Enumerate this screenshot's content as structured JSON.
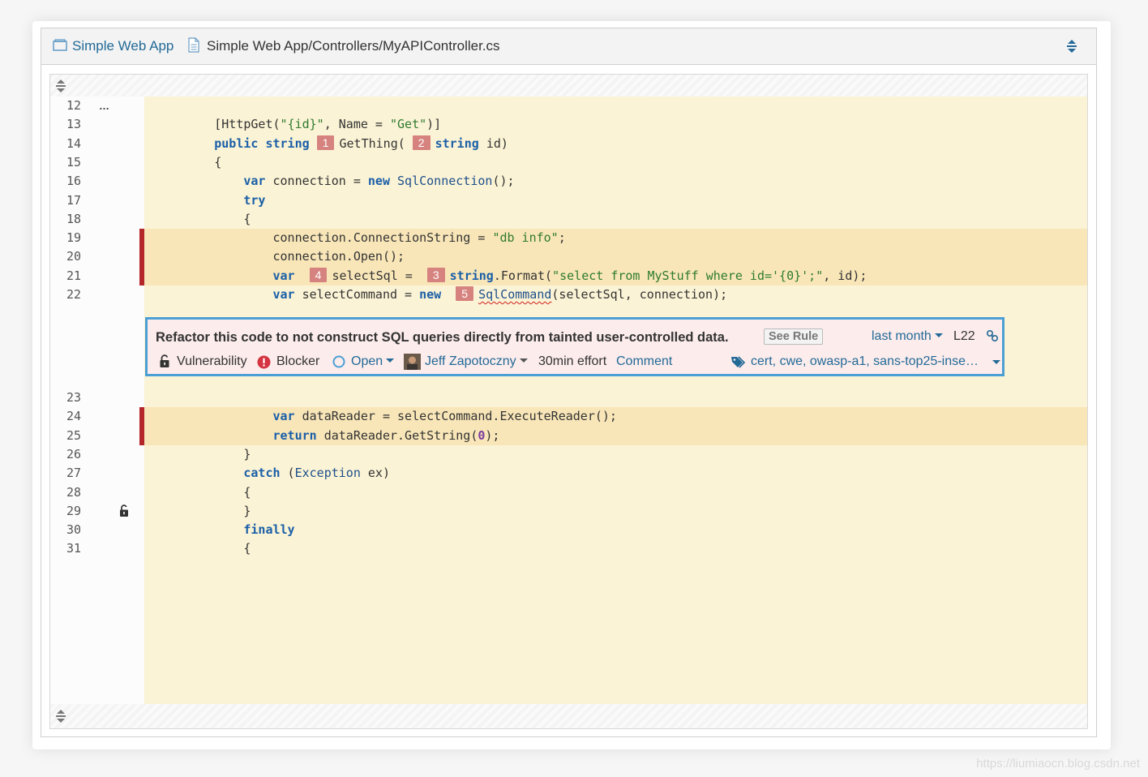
{
  "header": {
    "project_link": "Simple Web App",
    "file_path": "Simple Web App/Controllers/MyAPIController.cs"
  },
  "code_lines": [
    {
      "n": "12"
    },
    {
      "n": "13"
    },
    {
      "n": "14"
    },
    {
      "n": "15"
    },
    {
      "n": "16"
    },
    {
      "n": "17"
    },
    {
      "n": "18"
    },
    {
      "n": "19"
    },
    {
      "n": "20"
    },
    {
      "n": "21"
    },
    {
      "n": "22"
    },
    {
      "n": "23"
    },
    {
      "n": "24"
    },
    {
      "n": "25"
    },
    {
      "n": "26"
    },
    {
      "n": "27"
    },
    {
      "n": "28"
    },
    {
      "n": "29"
    },
    {
      "n": "30"
    },
    {
      "n": "31"
    }
  ],
  "code": {
    "ellipsis": "…",
    "l13": "[HttpGet(\"{id}\", Name = \"Get\")]",
    "l13_attr": "[HttpGet(",
    "l13_str1": "\"{id}\"",
    "l13_mid": ", Name = ",
    "l13_str2": "\"Get\"",
    "l13_end": ")]",
    "kw_public": "public",
    "kw_string": "string",
    "fn_getthing": "GetThing(",
    "id_param": "id)",
    "brace_open": "{",
    "brace_close": "}",
    "kw_var": "var",
    "connection_eq": "connection = ",
    "kw_new": "new",
    "type_sqlconnection": "SqlConnection",
    "paren_semi": "();",
    "kw_try": "try",
    "l19_a": "connection.ConnectionString = ",
    "l19_str": "\"db info\"",
    "l19_end": ";",
    "l20": "connection.Open();",
    "l21_selectsql": "selectSql = ",
    "l21_format": ".Format(",
    "l21_str": "\"select from MyStuff where id='{0}';\"",
    "l21_end": ", id);",
    "l22_selectcmd": "selectCommand = ",
    "type_sqlcommand": "SqlCommand",
    "l22_end": "(selectSql, connection);",
    "l24_a": "dataReader = selectCommand.ExecuteReader();",
    "kw_return": "return",
    "l25_a": "dataReader.GetString(",
    "l25_num": "0",
    "l25_end": ");",
    "kw_catch": "catch",
    "l27_a": " (",
    "type_exception": "Exception",
    "l27_end": " ex)",
    "kw_finally": "finally"
  },
  "locations": [
    "1",
    "2",
    "3",
    "4",
    "5"
  ],
  "issue": {
    "message": "Refactor this code to not construct SQL queries directly from tainted user-controlled data.",
    "see_rule": "See Rule",
    "date": "last month",
    "line": "L22",
    "type": "Vulnerability",
    "severity": "Blocker",
    "status": "Open",
    "assignee": "Jeff Zapotoczny",
    "effort": "30min effort",
    "comment": "Comment",
    "tags": "cert, cwe, owasp-a1, sans-top25-inse…"
  },
  "colors": {
    "accent": "#236a97",
    "issue_border": "#4b9fd5",
    "issue_bg": "#fcecec",
    "location_marker": "#d6837f",
    "code_bg": "#fbf3d5",
    "highlight_bg": "#f8e6b8",
    "severity_red": "#d4333f"
  },
  "watermark": "https://liumiaocn.blog.csdn.net"
}
